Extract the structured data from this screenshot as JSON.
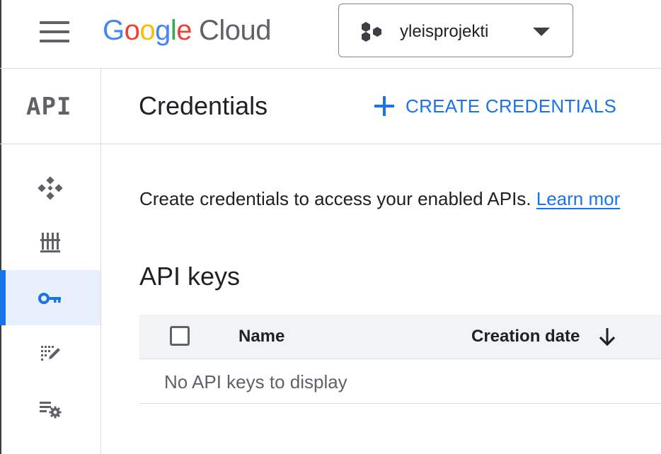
{
  "topbar": {
    "logo": {
      "letters": [
        {
          "char": "G",
          "color": "#4285F4"
        },
        {
          "char": "o",
          "color": "#EA4335"
        },
        {
          "char": "o",
          "color": "#FBBC05"
        },
        {
          "char": "g",
          "color": "#4285F4"
        },
        {
          "char": "l",
          "color": "#34A853"
        },
        {
          "char": "e",
          "color": "#EA4335"
        }
      ],
      "suffix": "Cloud"
    },
    "project_name": "yleisprojekti"
  },
  "rail": {
    "api_label": "API",
    "items": [
      {
        "icon": "enabled-apis-icon",
        "active": false
      },
      {
        "icon": "library-icon",
        "active": false
      },
      {
        "icon": "key-icon",
        "active": true
      },
      {
        "icon": "consent-screen-icon",
        "active": false
      },
      {
        "icon": "settings-list-icon",
        "active": false
      }
    ]
  },
  "header": {
    "title": "Credentials",
    "create_button_label": "CREATE CREDENTIALS"
  },
  "content": {
    "intro_text": "Create credentials to access your enabled APIs. ",
    "learn_more": "Learn mor",
    "section_title": "API keys",
    "table": {
      "columns": [
        "Name",
        "Creation date"
      ],
      "sort_icon": "arrow-down-icon",
      "empty_message": "No API keys to display"
    }
  },
  "colors": {
    "accent": "#1a73e8",
    "active_bg": "#e8f0fe",
    "icon_gray": "#5f6368",
    "divider": "#dadce0"
  }
}
